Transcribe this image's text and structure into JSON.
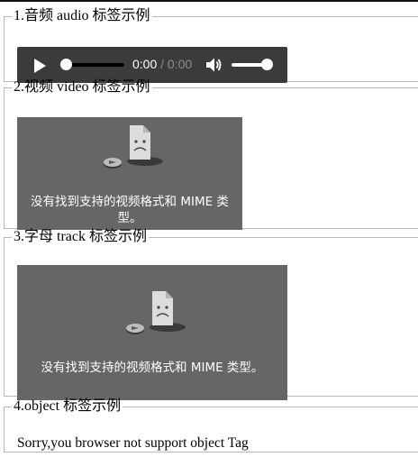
{
  "sections": [
    {
      "legend": "1.音频 audio 标签示例"
    },
    {
      "legend": "2.视频 video 标签示例"
    },
    {
      "legend": "3.字母 track 标签示例"
    },
    {
      "legend": "4.object 标签示例"
    }
  ],
  "audio": {
    "current_time": "0:00",
    "separator_duration": " / 0:00",
    "volume_level": 1.0
  },
  "video1": {
    "error_text": "没有找到支持的视频格式和 MIME 类型。"
  },
  "video2": {
    "error_text": "没有找到支持的视频格式和 MIME 类型。"
  },
  "object": {
    "fallback_text": "Sorry,you browser not support object Tag"
  },
  "icons": {
    "play": "play-icon",
    "volume": "volume-icon",
    "error": "broken-file-icon"
  },
  "colors": {
    "audio_bg": "#3b3b3b",
    "video_bg": "#666666",
    "border": "#b9b9b9"
  }
}
